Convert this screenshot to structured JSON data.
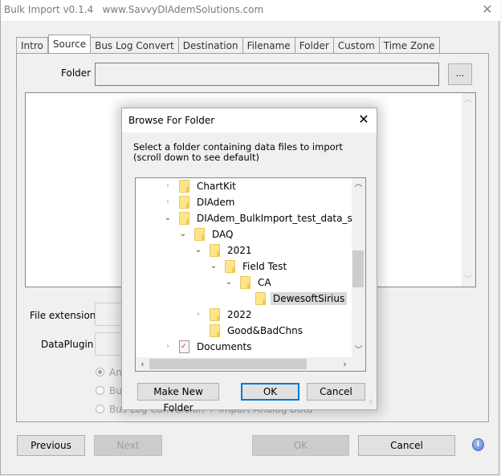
{
  "window": {
    "title": "Bulk Import v0.1.4   www.SavvyDIAdemSolutions.com",
    "close_icon": "close-icon"
  },
  "tabs": [
    {
      "label": "Intro",
      "active": false
    },
    {
      "label": "Source",
      "active": true
    },
    {
      "label": "Bus Log Convert",
      "active": false
    },
    {
      "label": "Destination",
      "active": false
    },
    {
      "label": "Filename",
      "active": false
    },
    {
      "label": "Folder",
      "active": false
    },
    {
      "label": "Custom",
      "active": false
    },
    {
      "label": "Time Zone",
      "active": false
    }
  ],
  "source": {
    "folder_label": "Folder",
    "folder_value": "",
    "browse_label": "...",
    "file_extension_label": "File extension",
    "file_extension_value": "",
    "dataplugin_label": "DataPlugin",
    "dataplugin_value": "",
    "radios": [
      {
        "label": "Analog Data",
        "checked": true
      },
      {
        "label": "Bus Log Conversion",
        "checked": false
      },
      {
        "label": "Bus Log Conversion + Import Analog Data",
        "checked": false
      }
    ]
  },
  "footer": {
    "previous": "Previous",
    "next": "Next",
    "ok": "OK",
    "cancel": "Cancel",
    "info_icon": "info-icon"
  },
  "dialog": {
    "title": "Browse For Folder",
    "instructions": "Select a folder containing data files to import (scroll down to see default)",
    "tree": [
      {
        "label": "ChartKit",
        "level": 0,
        "expander": "collapsed",
        "icon": "folder-icon",
        "selected": false
      },
      {
        "label": "DIAdem",
        "level": 0,
        "expander": "collapsed",
        "icon": "folder-icon",
        "selected": false
      },
      {
        "label": "DIAdem_BulkImport_test_data_sets",
        "level": 0,
        "expander": "expanded",
        "icon": "folder-icon",
        "selected": false
      },
      {
        "label": "DAQ",
        "level": 1,
        "expander": "expanded",
        "icon": "folder-icon",
        "selected": false
      },
      {
        "label": "2021",
        "level": 2,
        "expander": "expanded",
        "icon": "folder-icon",
        "selected": false
      },
      {
        "label": "Field Test",
        "level": 3,
        "expander": "expanded",
        "icon": "folder-icon",
        "selected": false
      },
      {
        "label": "CA",
        "level": 4,
        "expander": "expanded",
        "icon": "folder-icon",
        "selected": false
      },
      {
        "label": "DewesoftSirius",
        "level": 5,
        "expander": "none",
        "icon": "folder-icon",
        "selected": true
      },
      {
        "label": "2022",
        "level": 2,
        "expander": "collapsed",
        "icon": "folder-icon",
        "selected": false
      },
      {
        "label": "Good&BadChns",
        "level": 2,
        "expander": "none",
        "icon": "folder-icon",
        "selected": false
      },
      {
        "label": "Documents",
        "level": 0,
        "expander": "collapsed",
        "icon": "documents-icon",
        "selected": false
      }
    ],
    "make_new_folder": "Make New Folder",
    "ok": "OK",
    "cancel": "Cancel"
  }
}
